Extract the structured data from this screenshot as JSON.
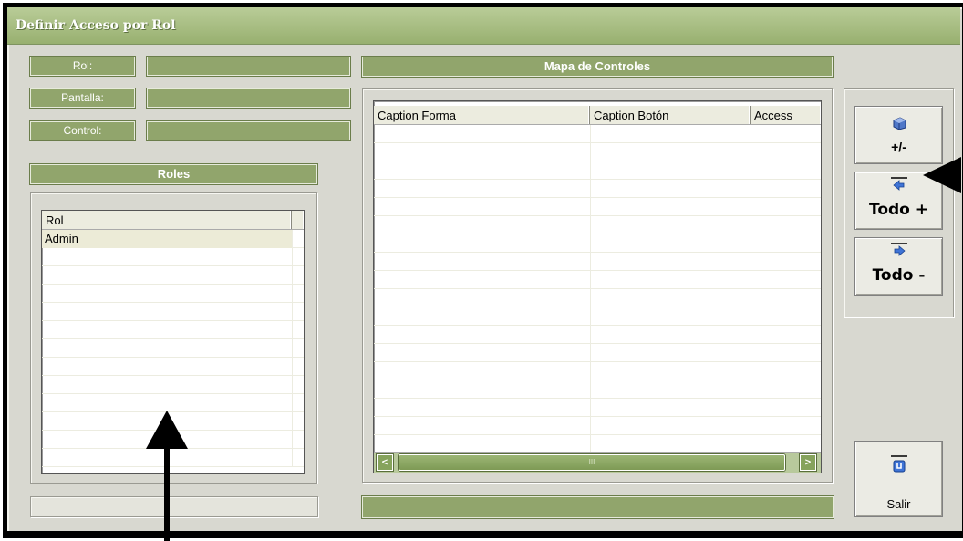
{
  "window": {
    "title": "Definir Acceso por Rol"
  },
  "fields": {
    "rol_label": "Rol:",
    "pantalla_label": "Pantalla:",
    "control_label": "Control:"
  },
  "roles": {
    "header": "Roles",
    "column": "Rol",
    "items": [
      "Admin"
    ]
  },
  "mapa": {
    "header": "Mapa de Controles",
    "columns": [
      "Caption Forma",
      "Caption Botón",
      "Access"
    ],
    "scroll_thumb": "III"
  },
  "buttons": {
    "toggle": "+/-",
    "todo_plus": "Todo +",
    "todo_minus": "Todo -",
    "salir": "Salir"
  }
}
